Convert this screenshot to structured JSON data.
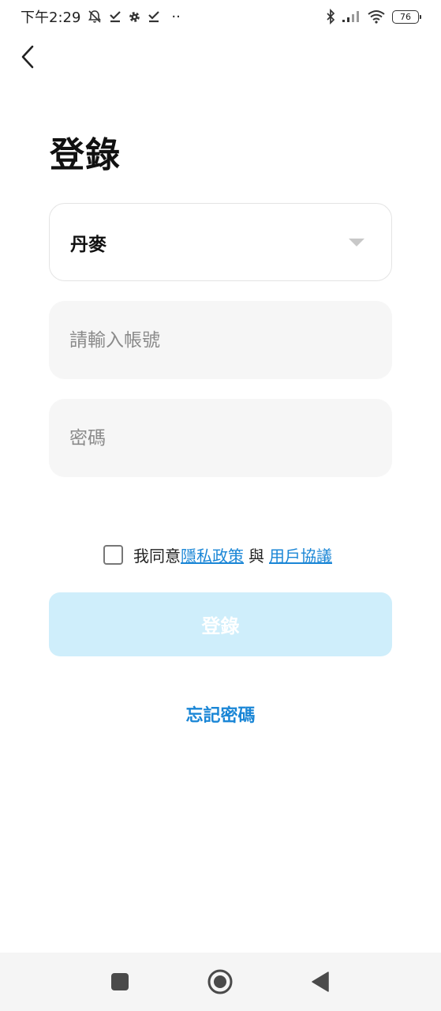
{
  "status_bar": {
    "time": "下午2:29",
    "battery": "76",
    "more": "··"
  },
  "title": "登錄",
  "country_select": {
    "value": "丹麥"
  },
  "account": {
    "placeholder": "請輸入帳號",
    "value": ""
  },
  "password": {
    "placeholder": "密碼",
    "value": ""
  },
  "agreement": {
    "prefix": "我同意",
    "privacy_link": "隱私政策",
    "and": "與",
    "terms_link": "用戶協議",
    "checked": false
  },
  "login_button": {
    "label": "登錄",
    "enabled": false
  },
  "forgot_password": "忘記密碼",
  "colors": {
    "accent": "#1a86d6",
    "button_disabled": "#cfeefb",
    "input_bg": "#f6f6f6"
  },
  "icons": [
    "bell-off-icon",
    "download-done-icon",
    "settings-icon",
    "bluetooth-icon",
    "signal-icon",
    "wifi-icon",
    "battery-icon",
    "back-arrow-icon",
    "dropdown-arrow-icon",
    "nav-recent-icon",
    "nav-home-icon",
    "nav-back-icon"
  ]
}
